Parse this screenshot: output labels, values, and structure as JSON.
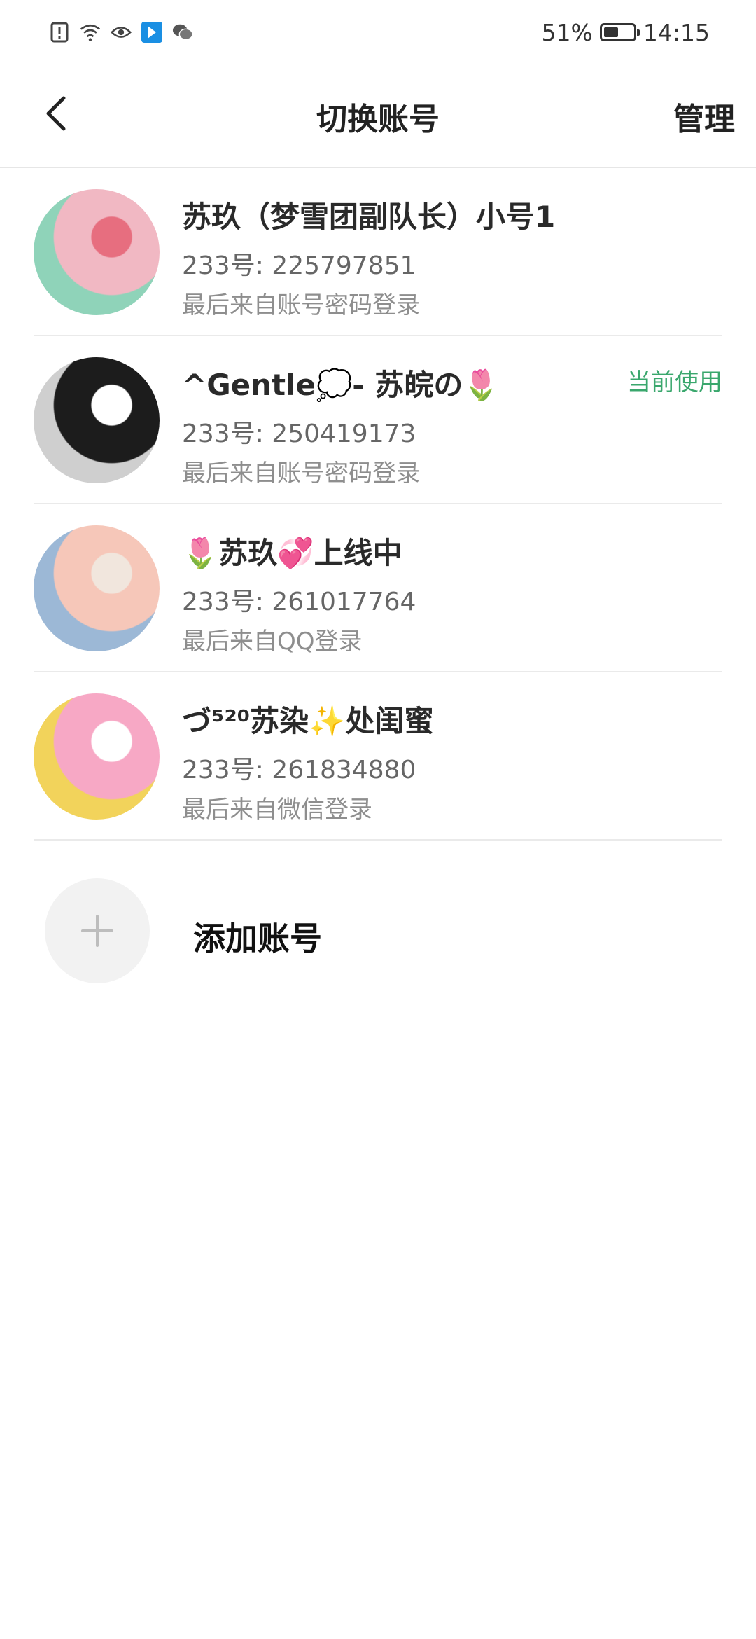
{
  "status_bar": {
    "battery": "51%",
    "battery_level": 0.51,
    "time": "14:15",
    "icons": [
      "alert-icon",
      "wifi-icon",
      "eye-icon",
      "app-icon",
      "wechat-icon"
    ]
  },
  "header": {
    "title": "切换账号",
    "manage_label": "管理"
  },
  "accounts": [
    {
      "name": "苏玖（梦雪团副队长）小号1",
      "id_line": "233号: 225797851",
      "login": "最后来自账号密码登录",
      "current_label": "",
      "avatar_colors": [
        "#f1b8c3",
        "#8fd3b9",
        "#e76e7f"
      ]
    },
    {
      "name": "^Gentle💭- 苏皖の🌷",
      "id_line": "233号: 250419173",
      "login": "最后来自账号密码登录",
      "current_label": "当前使用",
      "avatar_colors": [
        "#1c1c1c",
        "#cfcfcf",
        "#ffffff"
      ]
    },
    {
      "name": "🌷苏玖💞上线中",
      "id_line": "233号: 261017764",
      "login": "最后来自QQ登录",
      "current_label": "",
      "avatar_colors": [
        "#f6c7b9",
        "#9cb8d6",
        "#f1e6dd"
      ]
    },
    {
      "name": "づ⁵²⁰苏染✨处闺蜜",
      "id_line": "233号: 261834880",
      "login": "最后来自微信登录",
      "current_label": "",
      "avatar_colors": [
        "#f7a8c5",
        "#f2d35b",
        "#ffffff"
      ]
    }
  ],
  "add_account": {
    "label": "添加账号"
  },
  "colors": {
    "accent_green": "#3aa76d",
    "divider": "#eaeaea"
  }
}
